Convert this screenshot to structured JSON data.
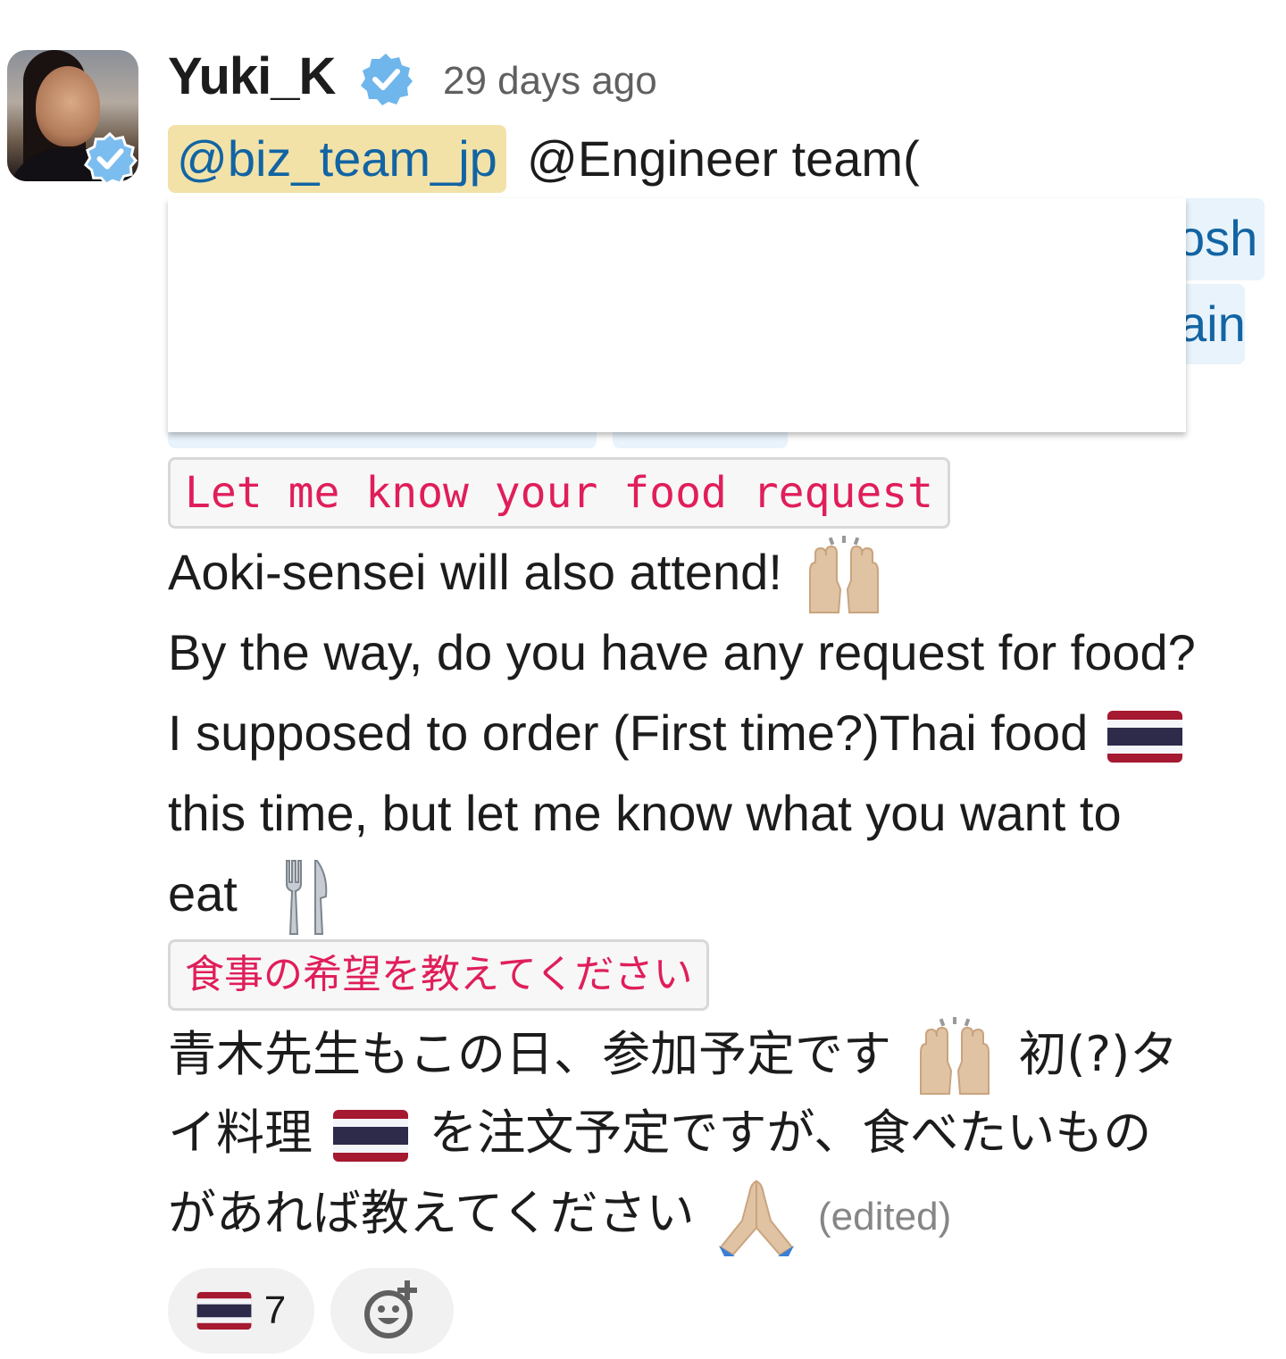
{
  "author": {
    "name": "Yuki_K",
    "timestamp": "29 days ago"
  },
  "mentions": {
    "user_group": "@biz_team_jp",
    "rest": "@Engineer team(",
    "hidden_fragment_1": "osh",
    "hidden_fragment_2": "ain"
  },
  "message": {
    "code_en": "Let me know your food request",
    "line_1": "Aoki-sensei will also attend!",
    "line_2": "By the way, do you have any request for food?",
    "line_3": "I supposed to order (First time?)Thai food",
    "line_4": "this time, but let me know what you want to",
    "line_5": "eat",
    "code_jp": "食事の希望を教えてください",
    "jp_line_1a": "青木先生もこの日、参加予定です",
    "jp_line_1b": "初(?)タ",
    "jp_line_2a": "イ料理",
    "jp_line_2b": "を注文予定ですが、食べたいもの",
    "jp_line_3": "があれば教えてください",
    "edited": "(edited)"
  },
  "reactions": [
    {
      "emoji": "thailand-flag",
      "count": "7"
    }
  ],
  "icons": {
    "verified": "verified-check-icon",
    "raised_hands": "raised-hands-icon",
    "thai_flag": "thailand-flag-icon",
    "fork_knife": "fork-and-knife-icon",
    "pray": "folded-hands-icon",
    "add_reaction": "add-reaction-icon"
  },
  "colors": {
    "mention_bg": "#f2e2a8",
    "mention_text": "#1264a3",
    "code_text": "#e01e5a",
    "verified_blue": "#6fb6ec"
  }
}
